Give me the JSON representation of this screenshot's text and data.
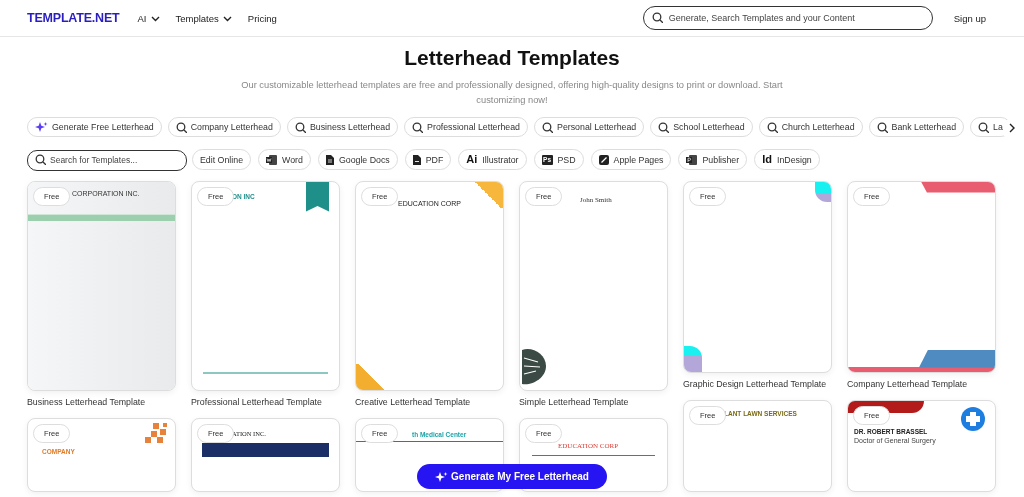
{
  "header": {
    "logo": "TEMPLATE.NET",
    "nav": [
      {
        "label": "AI",
        "dropdown": true
      },
      {
        "label": "Templates",
        "dropdown": true
      },
      {
        "label": "Pricing",
        "dropdown": false
      }
    ],
    "search_placeholder": "Generate, Search Templates and your Content",
    "signup": "Sign up"
  },
  "title": "Letterhead Templates",
  "subtitle": "Our customizable letterhead templates are free and professionally designed, offering high-quality designs to print or download. Start customizing now!",
  "category_chips": [
    {
      "label": "Generate Free Letterhead",
      "kind": "generate"
    },
    {
      "label": "Company Letterhead",
      "kind": "search"
    },
    {
      "label": "Business Letterhead",
      "kind": "search"
    },
    {
      "label": "Professional Letterhead",
      "kind": "search"
    },
    {
      "label": "Personal Letterhead",
      "kind": "search"
    },
    {
      "label": "School Letterhead",
      "kind": "search"
    },
    {
      "label": "Church Letterhead",
      "kind": "search"
    },
    {
      "label": "Bank Letterhead",
      "kind": "search"
    },
    {
      "label": "La",
      "kind": "search"
    }
  ],
  "filters": {
    "search_placeholder": "Search for Templates...",
    "formats": [
      {
        "label": "Edit Online",
        "kind": "plain"
      },
      {
        "label": "Word",
        "kind": "word"
      },
      {
        "label": "Google Docs",
        "kind": "docs"
      },
      {
        "label": "PDF",
        "kind": "pdf"
      },
      {
        "label": "Illustrator",
        "kind": "lettered",
        "icon_text": "Ai"
      },
      {
        "label": "PSD",
        "kind": "boxed",
        "icon_text": "Ps"
      },
      {
        "label": "Apple Pages",
        "kind": "pages"
      },
      {
        "label": "Publisher",
        "kind": "publisher"
      },
      {
        "label": "InDesign",
        "kind": "lettered",
        "icon_text": "Id"
      }
    ]
  },
  "columns": [
    [
      {
        "badge": "Free",
        "title": "Business Letterhead Template",
        "kind": "business",
        "heading": "CORPORATION INC."
      },
      {
        "badge": "Free",
        "kind": "orange",
        "heading": "COMPANY"
      }
    ],
    [
      {
        "badge": "Free",
        "title": "Professional Letterhead Template",
        "kind": "professional",
        "heading": "ON INC"
      },
      {
        "badge": "Free",
        "kind": "navy",
        "heading": "ATION INC."
      }
    ],
    [
      {
        "badge": "Free",
        "title": "Creative Letterhead Template",
        "kind": "creative",
        "heading": "EDUCATION CORP"
      },
      {
        "badge": "Free",
        "kind": "medical",
        "heading": "th Medical Center"
      }
    ],
    [
      {
        "badge": "Free",
        "title": "Simple Letterhead Template",
        "kind": "simple",
        "heading": "John Smith"
      },
      {
        "badge": "Free",
        "kind": "redline",
        "heading": "EDUCATION CORP"
      }
    ],
    [
      {
        "badge": "Free",
        "title": "Graphic Design Letterhead Template",
        "kind": "graphic"
      },
      {
        "badge": "Free",
        "kind": "lawn",
        "heading": "LANT LAWN SERVICES"
      }
    ],
    [
      {
        "badge": "Free",
        "title": "Company Letterhead Template",
        "kind": "company"
      },
      {
        "badge": "Free",
        "kind": "doctor",
        "heading": "DR. ROBERT BRASSEL",
        "subheading": "Doctor of General Surgery"
      }
    ]
  ],
  "cta": "Generate My Free Letterhead"
}
